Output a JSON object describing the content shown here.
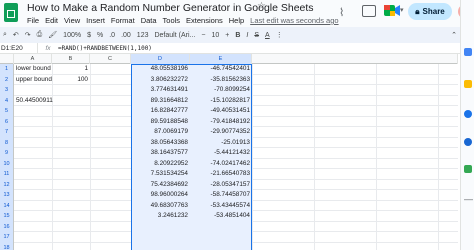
{
  "title": "How to Make a Random Number Generator in Google Sheets",
  "menus": [
    "File",
    "Edit",
    "View",
    "Insert",
    "Format",
    "Data",
    "Tools",
    "Extensions",
    "Help"
  ],
  "last_edit": "Last edit was seconds ago",
  "share_label": "Share",
  "toolbar": {
    "zoom": "100%",
    "currency": "$",
    "percent": "%",
    "dec_less": ".0",
    "dec_more": ".00",
    "number_format": "123",
    "font": "Default (Ari...",
    "font_size": "10"
  },
  "name_box": "D1:E20",
  "formula": "=RAND()+RANDBETWEEN(1,100)",
  "columns": [
    "A",
    "B",
    "C",
    "D",
    "E"
  ],
  "rows": [
    {
      "n": "1",
      "a": "lower bound",
      "b": "1",
      "d": "48.05538196",
      "e": "-46.74542401"
    },
    {
      "n": "2",
      "a": "upper bound",
      "b": "100",
      "d": "3.806232272",
      "e": "-35.81562363"
    },
    {
      "n": "3",
      "a": "",
      "b": "",
      "d": "3.774631491",
      "e": "-70.8099254"
    },
    {
      "n": "4",
      "a": "50.44500911",
      "b": "",
      "d": "89.31664812",
      "e": "-15.10282817"
    },
    {
      "n": "5",
      "a": "",
      "b": "",
      "d": "16.82842777",
      "e": "-49.40531451"
    },
    {
      "n": "6",
      "a": "",
      "b": "",
      "d": "89.59188548",
      "e": "-79.41848192"
    },
    {
      "n": "7",
      "a": "",
      "b": "",
      "d": "87.0069179",
      "e": "-29.90774352"
    },
    {
      "n": "8",
      "a": "",
      "b": "",
      "d": "38.05643368",
      "e": "-25.01913"
    },
    {
      "n": "9",
      "a": "",
      "b": "",
      "d": "38.16437577",
      "e": "-5.44121432"
    },
    {
      "n": "10",
      "a": "",
      "b": "",
      "d": "8.20922952",
      "e": "-74.02417462"
    },
    {
      "n": "11",
      "a": "",
      "b": "",
      "d": "7.531534254",
      "e": "-21.66540783"
    },
    {
      "n": "12",
      "a": "",
      "b": "",
      "d": "75.42384692",
      "e": "-28.05347157"
    },
    {
      "n": "13",
      "a": "",
      "b": "",
      "d": "98.96000264",
      "e": "-58.74458707"
    },
    {
      "n": "14",
      "a": "",
      "b": "",
      "d": "49.68307763",
      "e": "-53.43445574"
    },
    {
      "n": "15",
      "a": "",
      "b": "",
      "d": "3.2461232",
      "e": "-53.4851404"
    },
    {
      "n": "16",
      "a": "",
      "b": "",
      "d": "",
      "e": ""
    },
    {
      "n": "17",
      "a": "",
      "b": "",
      "d": "",
      "e": ""
    },
    {
      "n": "18",
      "a": "",
      "b": "",
      "d": "",
      "e": ""
    }
  ],
  "colors": {
    "selection": "#1a73e8",
    "selection_fill": "#e8f0fe",
    "share_bg": "#c2e7ff",
    "sheets_green": "#0f9d58"
  }
}
